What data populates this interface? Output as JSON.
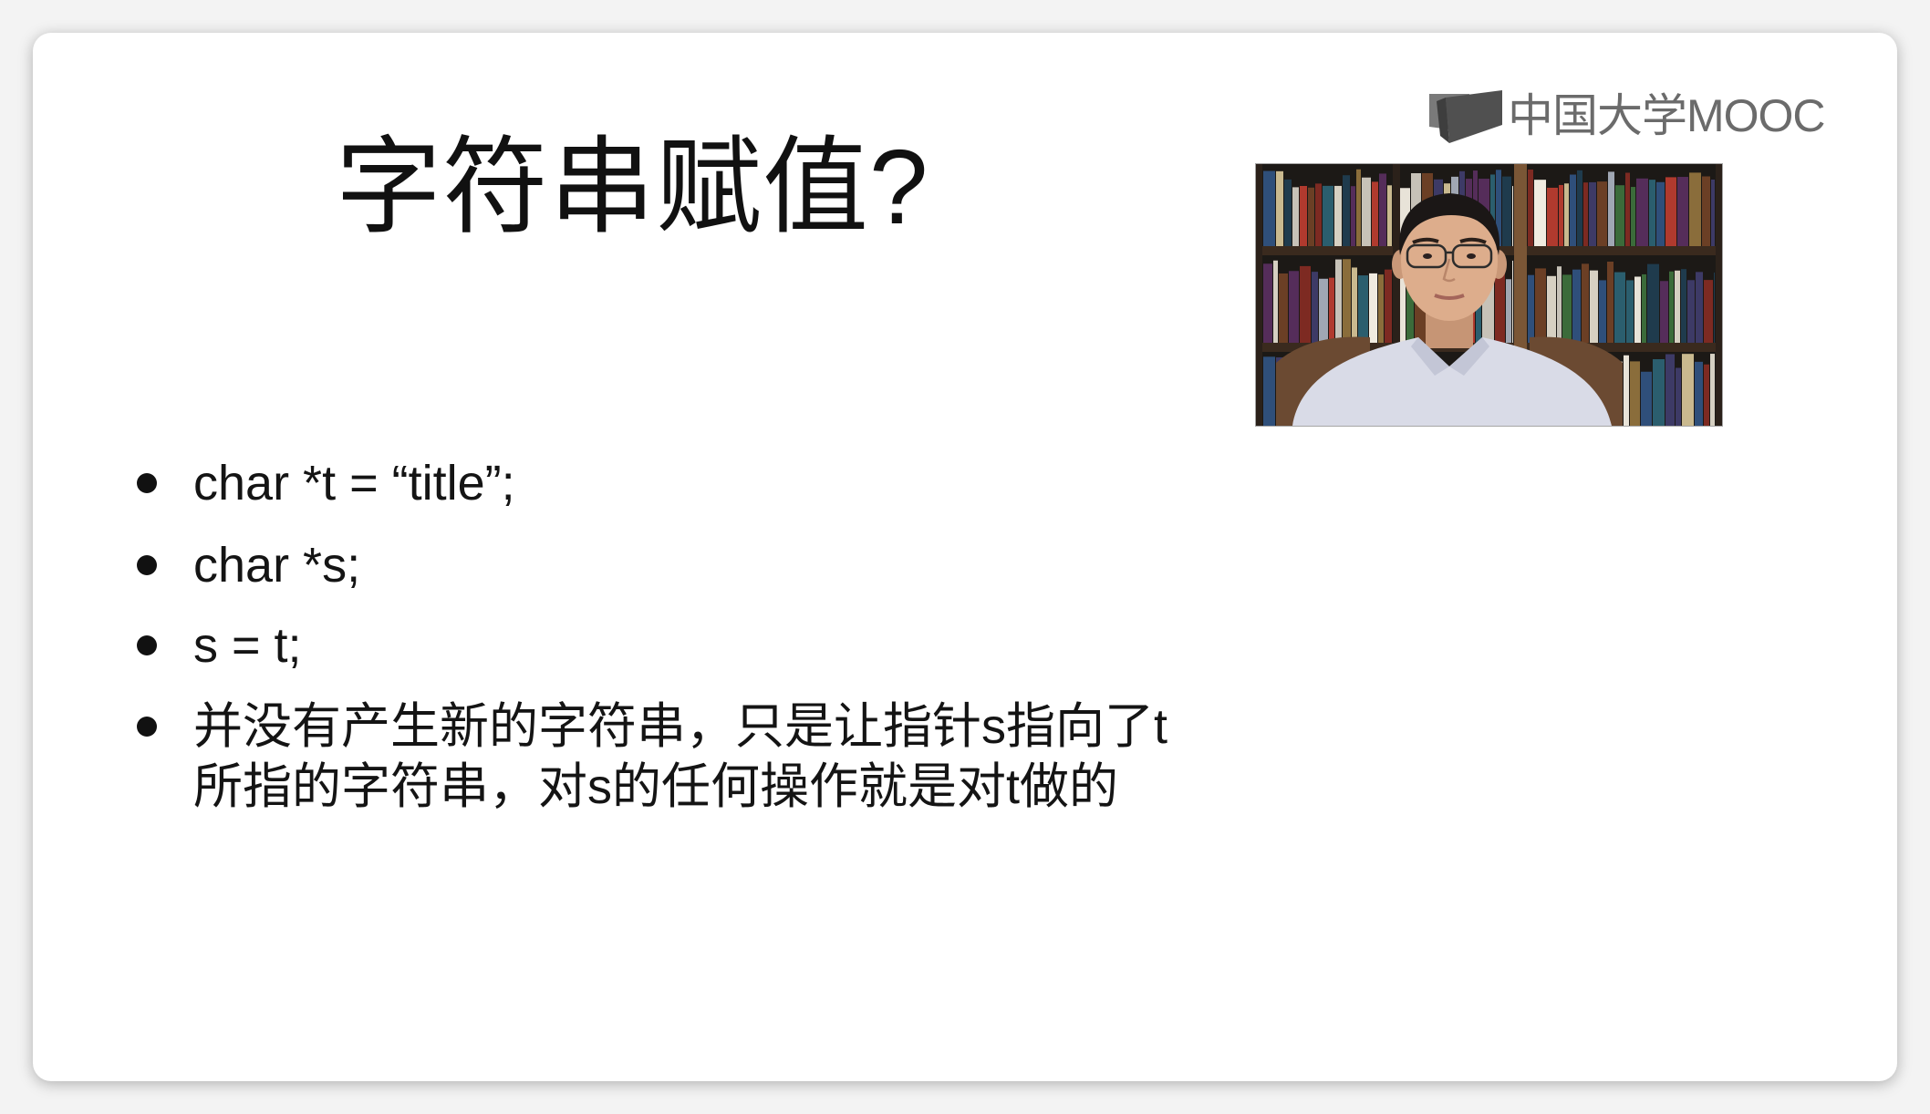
{
  "slide": {
    "title": "字符串赋值?",
    "bullets": [
      {
        "text": "char *t = “title”;"
      },
      {
        "text": "char *s;"
      },
      {
        "text": "s = t;"
      },
      {
        "lines": [
          "并没有产生新的字符串，只是让指针s指向了t",
          "所指的字符串，对s的任何操作就是对t做的"
        ]
      }
    ]
  },
  "logo": {
    "text": "中国大学MOOC",
    "icon": "open-book-icon",
    "color": "#6b6b6b"
  },
  "video": {
    "icon": "instructor-webcam-feed"
  },
  "colors": {
    "text": "#111111",
    "card": "#ffffff",
    "page": "#f3f3f3"
  }
}
